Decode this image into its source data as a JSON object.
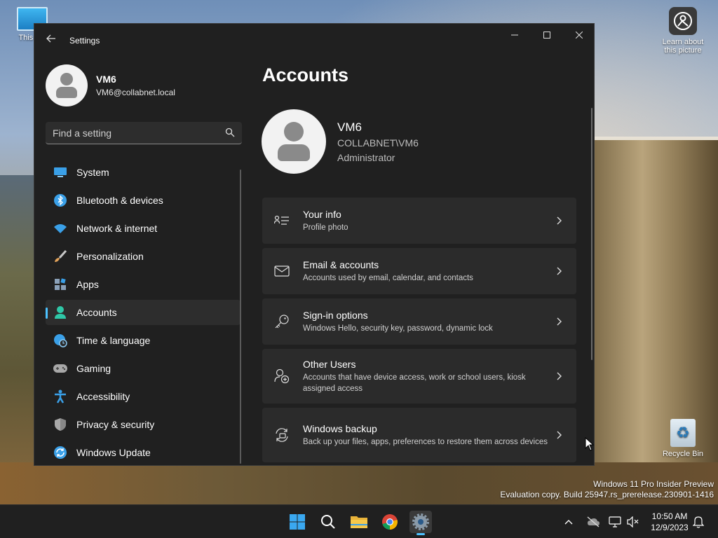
{
  "desktop": {
    "icons": {
      "this_pc": "This PC",
      "learn_line1": "Learn about",
      "learn_line2": "this picture",
      "recycle_bin": "Recycle Bin"
    },
    "watermark": {
      "line1": "Windows 11 Pro Insider Preview",
      "line2": "Evaluation copy. Build 25947.rs_prerelease.230901-1416"
    }
  },
  "window": {
    "title": "Settings",
    "controls": {
      "minimize": "─",
      "maximize": "☐",
      "close": "✕"
    }
  },
  "profile": {
    "name": "VM6",
    "email": "VM6@collabnet.local"
  },
  "search": {
    "placeholder": "Find a setting"
  },
  "nav": {
    "items": [
      {
        "label": "System",
        "icon": "system-icon",
        "color": "#3aa0e8"
      },
      {
        "label": "Bluetooth & devices",
        "icon": "bluetooth-icon",
        "color": "#3aa0e8"
      },
      {
        "label": "Network & internet",
        "icon": "wifi-icon",
        "color": "#3aa0e8"
      },
      {
        "label": "Personalization",
        "icon": "brush-icon",
        "color": "#e3a35a"
      },
      {
        "label": "Apps",
        "icon": "apps-icon",
        "color": "#8aa0b8"
      },
      {
        "label": "Accounts",
        "icon": "person-icon",
        "color": "#2fc7a7",
        "active": true
      },
      {
        "label": "Time & language",
        "icon": "globe-clock-icon",
        "color": "#3aa0e8"
      },
      {
        "label": "Gaming",
        "icon": "gamepad-icon",
        "color": "#a8a8a8"
      },
      {
        "label": "Accessibility",
        "icon": "accessibility-icon",
        "color": "#3aa0e8"
      },
      {
        "label": "Privacy & security",
        "icon": "shield-icon",
        "color": "#a8a8a8"
      },
      {
        "label": "Windows Update",
        "icon": "update-icon",
        "color": "#3aa0e8"
      }
    ]
  },
  "page": {
    "title": "Accounts",
    "account": {
      "name": "VM6",
      "domain": "COLLABNET\\VM6",
      "role": "Administrator"
    },
    "cards": [
      {
        "title": "Your info",
        "subtitle": "Profile photo",
        "icon": "person-card-icon"
      },
      {
        "title": "Email & accounts",
        "subtitle": "Accounts used by email, calendar, and contacts",
        "icon": "mail-icon"
      },
      {
        "title": "Sign-in options",
        "subtitle": "Windows Hello, security key, password, dynamic lock",
        "icon": "key-icon"
      },
      {
        "title": "Other Users",
        "subtitle": "Accounts that have device access, work or school users, kiosk assigned access",
        "icon": "person-add-icon"
      },
      {
        "title": "Windows backup",
        "subtitle": "Back up your files, apps, preferences to restore them across devices",
        "icon": "backup-icon"
      }
    ]
  },
  "taskbar": {
    "apps": [
      "start-icon",
      "search-icon",
      "file-explorer-icon",
      "chrome-icon",
      "settings-icon"
    ],
    "clock": {
      "time": "10:50 AM",
      "date": "12/9/2023"
    }
  },
  "colors": {
    "accent": "#4cc2ff",
    "window_bg": "#202020",
    "card_bg": "#2b2b2b"
  }
}
